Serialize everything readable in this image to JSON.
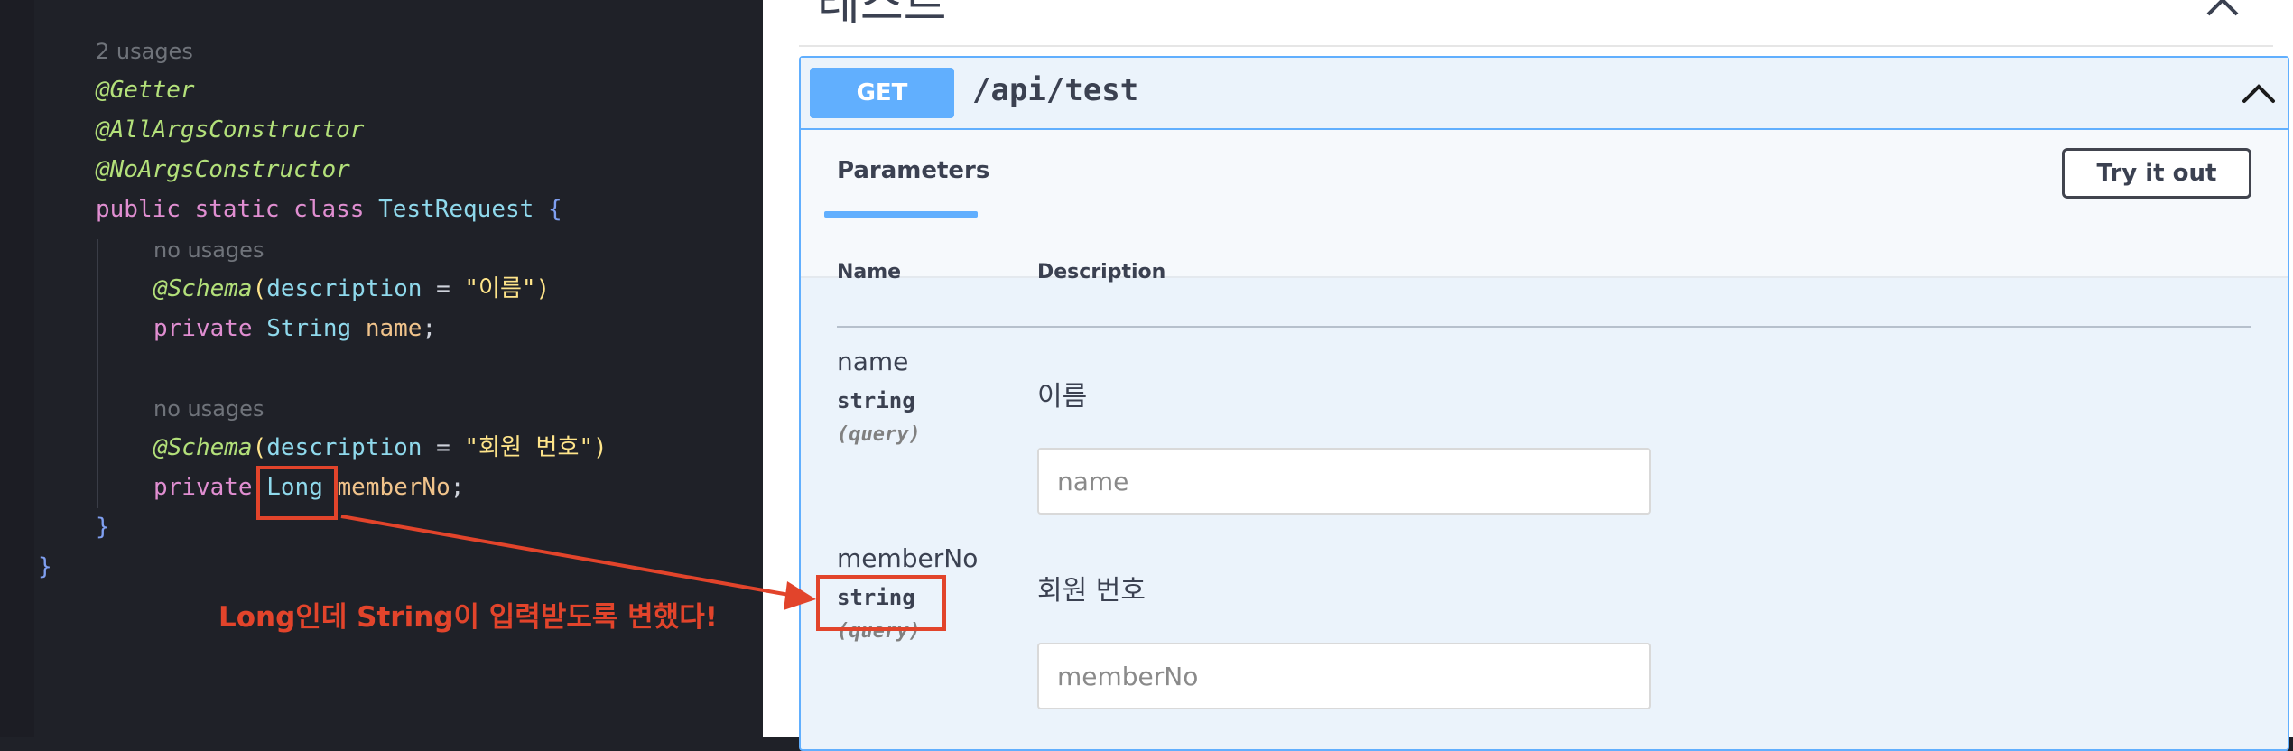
{
  "editor": {
    "usage_hint_class": "2 usages",
    "usage_hint_name": "no usages",
    "usage_hint_member": "no usages",
    "ann_getter": "@Getter",
    "ann_all_args": "@AllArgsConstructor",
    "ann_no_args": "@NoArgsConstructor",
    "kw_public": "public",
    "kw_static": "static",
    "kw_class": "class",
    "class_name": "TestRequest",
    "brace_open": "{",
    "brace_close": "}",
    "outer_brace_close": "}",
    "ann_schema": "@Schema",
    "paren_open": "(",
    "paren_close": ")",
    "attr_description": "description",
    "equals": " = ",
    "desc_name": "\"이름\"",
    "desc_member": "\"회원 번호\"",
    "kw_private": "private",
    "type_string": "String",
    "type_long": "Long",
    "field_name": "name",
    "field_member": "memberNo",
    "semicolon": ";"
  },
  "swagger": {
    "section_title_fragment": "테스트",
    "method": "GET",
    "path": "/api/test",
    "tab_parameters": "Parameters",
    "try_it_out": "Try it out",
    "col_name": "Name",
    "col_description": "Description",
    "params": [
      {
        "name": "name",
        "type": "string",
        "in": "(query)",
        "description": "이름",
        "placeholder": "name"
      },
      {
        "name": "memberNo",
        "type": "string",
        "in": "(query)",
        "description": "회원 번호",
        "placeholder": "memberNo"
      }
    ],
    "method_color": "#61affe"
  },
  "annotation": {
    "callout": "Long인데 String이 입력받도록 변했다!",
    "color": "#e2442b"
  }
}
